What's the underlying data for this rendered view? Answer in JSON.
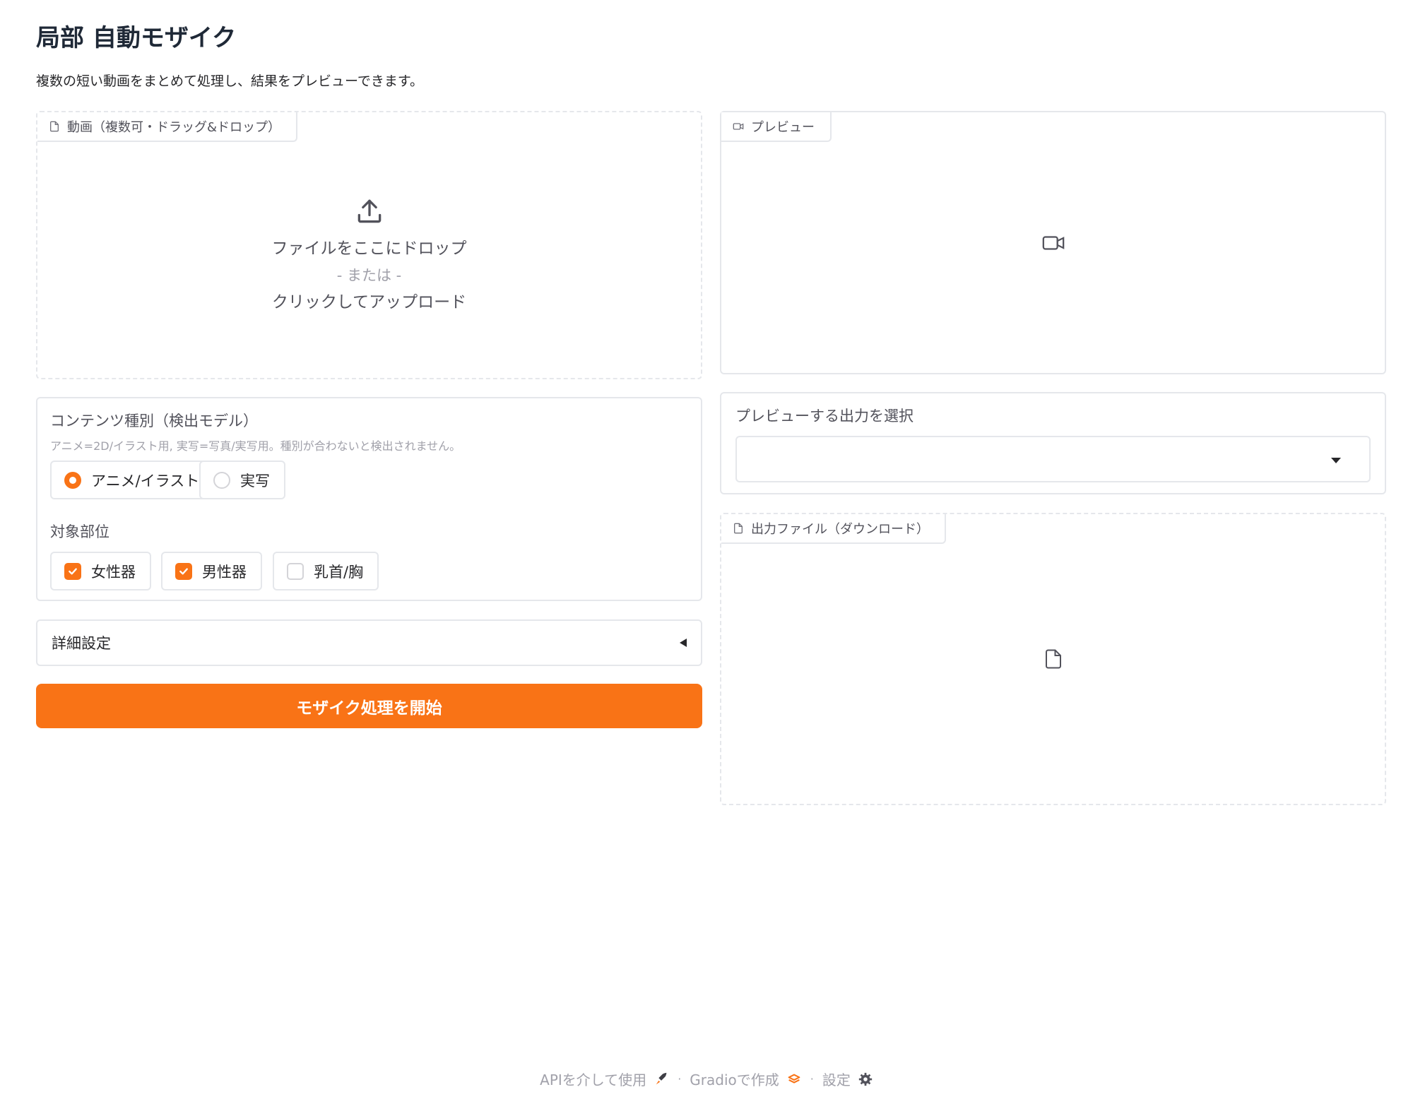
{
  "app": {
    "title": "局部 自動モザイク",
    "description": "複数の短い動画をまとめて処理し、結果をプレビューできます。"
  },
  "video_input": {
    "label": "動画（複数可・ドラッグ&ドロップ）",
    "drop_text": "ファイルをここにドロップ",
    "or_text": "- または -",
    "click_text": "クリックしてアップロード"
  },
  "preview": {
    "label": "プレビュー"
  },
  "content_type": {
    "label": "コンテンツ種別（検出モデル）",
    "info": "アニメ=2D/イラスト用, 実写=写真/実写用。種別が合わないと検出されません。",
    "options": [
      {
        "label": "アニメ/イラスト",
        "selected": true
      },
      {
        "label": "実写",
        "selected": false
      }
    ]
  },
  "target_parts": {
    "label": "対象部位",
    "options": [
      {
        "label": "女性器",
        "checked": true
      },
      {
        "label": "男性器",
        "checked": true
      },
      {
        "label": "乳首/胸",
        "checked": false
      }
    ]
  },
  "advanced": {
    "label": "詳細設定"
  },
  "run_button": {
    "label": "モザイク処理を開始"
  },
  "output_select": {
    "label": "プレビューする出力を選択",
    "value": ""
  },
  "output_file": {
    "label": "出力ファイル（ダウンロード）"
  },
  "footer": {
    "api": "APIを介して使用",
    "built_with": "Gradioで作成",
    "settings": "設定",
    "separator": "·"
  },
  "colors": {
    "accent": "#f97316",
    "border": "#e5e7eb",
    "muted": "#a1a1aa"
  }
}
